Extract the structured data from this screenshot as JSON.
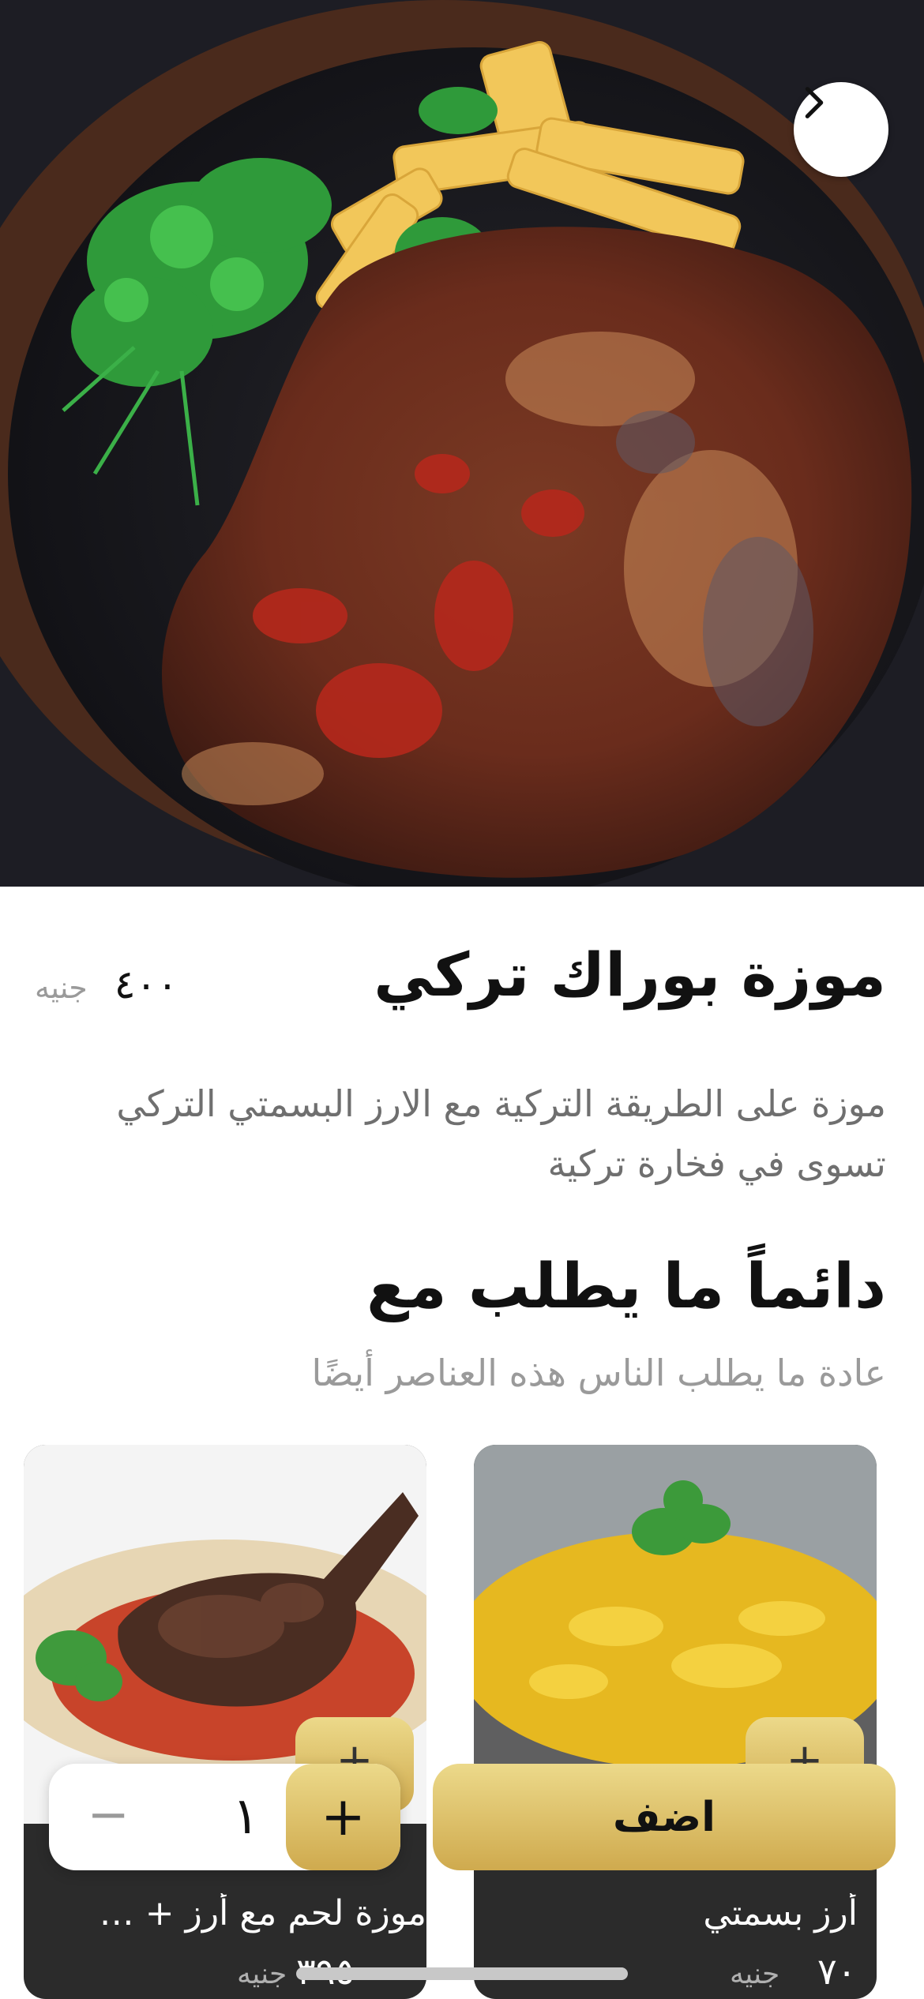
{
  "hero": {
    "image_alt": "",
    "back_icon": "chevron-right-icon"
  },
  "product": {
    "title": "موزة بوراك تركي",
    "price": "٤٠٠",
    "currency": "جنيه",
    "description": "موزة على الطريقة التركية مع الارز البسمتي التركي تسوى في فخارة تركية"
  },
  "section": {
    "title": "دائماً ما يطلب مع",
    "subtitle": "عادة ما يطلب الناس هذه العناصر أيضًا"
  },
  "cards": [
    {
      "name": "أرز بسمتي",
      "price": "٧٠",
      "currency": "جنيه",
      "plus": "+"
    },
    {
      "name": "موزة لحم مع أرز + ب...",
      "price": "٣٩٥",
      "currency": "جنيه",
      "plus": "+"
    }
  ],
  "bottom_bar": {
    "minus": "−",
    "quantity": "١",
    "plus": "+",
    "add_label": "اضف"
  },
  "colors": {
    "accent_gold": "#d9bc63",
    "card_bg": "#2b2b2b",
    "muted_text": "#9a9a9a"
  }
}
